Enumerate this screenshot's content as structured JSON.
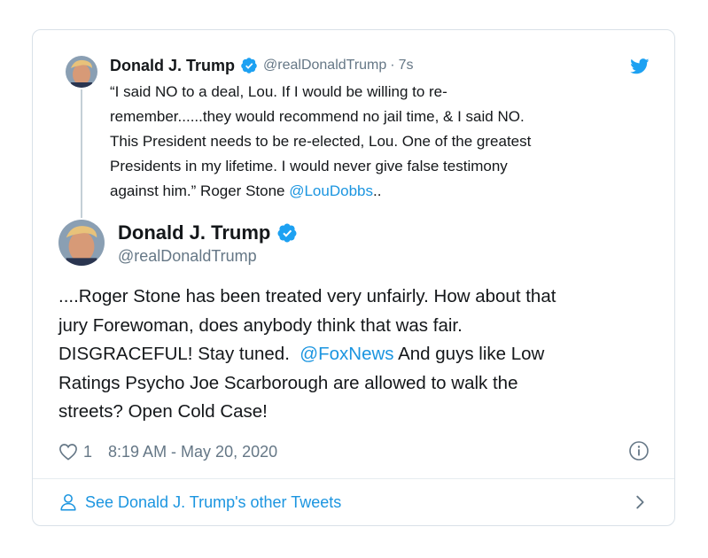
{
  "parent_tweet": {
    "name": "Donald J. Trump",
    "handle": "@realDonaldTrump",
    "separator": "·",
    "time": "7s",
    "text_line1": "“I said NO to a deal, Lou. If I would be willing to re-",
    "text_line2": "remember......they would recommend no jail time, & I said NO.",
    "text_line3": "This President needs to be re-elected, Lou. One of the greatest",
    "text_line4": "Presidents in my lifetime. I would never give false testimony",
    "text_line5_pre": "against him.” Roger Stone ",
    "text_line5_link": "@LouDobbs",
    "text_line5_post": ".."
  },
  "main_tweet": {
    "name": "Donald J. Trump",
    "handle": "@realDonaldTrump",
    "line1": "....Roger Stone has been treated very unfairly. How about that",
    "line2": "jury Forewoman, does anybody think that was fair.",
    "line3_pre": "DISGRACEFUL! Stay tuned.  ",
    "line3_link": "@FoxNews",
    "line3_post": " And guys like Low",
    "line4": "Ratings Psycho Joe Scarborough are allowed to walk the",
    "line5": "streets? Open Cold Case!",
    "like_count": "1",
    "timestamp": "8:19 AM - May 20, 2020"
  },
  "footer": {
    "link_text": "See Donald J. Trump's other Tweets"
  },
  "icons": {
    "verified": "verified-badge-icon",
    "bird": "twitter-bird-icon",
    "heart": "heart-icon",
    "info": "info-icon",
    "person": "person-icon",
    "chevron": "chevron-right-icon"
  },
  "colors": {
    "link": "#1b95e0",
    "secondary_text": "#657786",
    "primary_text": "#14171a",
    "verified": "#1da1f2"
  }
}
